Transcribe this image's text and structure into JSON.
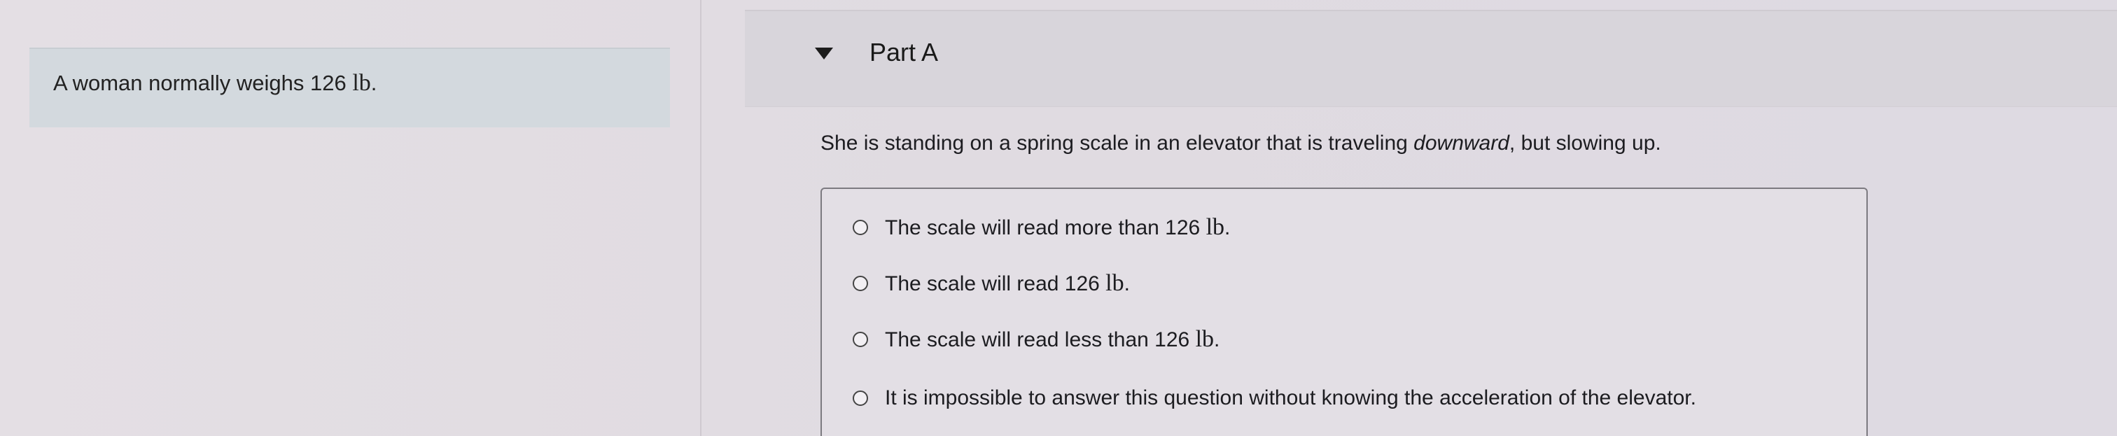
{
  "problem": {
    "statement": "A woman normally weighs 126",
    "unit": "lb",
    "end": "."
  },
  "part": {
    "title": "Part A",
    "question_before": "She is standing on a spring scale in an elevator that is traveling ",
    "question_emphasis": "downward",
    "question_after": ", but slowing up."
  },
  "options": [
    {
      "text": "The scale will read more than 126",
      "unit": "lb",
      "end": ".",
      "selected": false
    },
    {
      "text": "The scale will read 126",
      "unit": "lb",
      "end": ".",
      "selected": false
    },
    {
      "text": "The scale will read less than 126",
      "unit": "lb",
      "end": ".",
      "selected": false
    },
    {
      "text": "It is impossible to answer this question without knowing the acceleration of the elevator.",
      "unit": "",
      "end": "",
      "selected": false
    }
  ]
}
